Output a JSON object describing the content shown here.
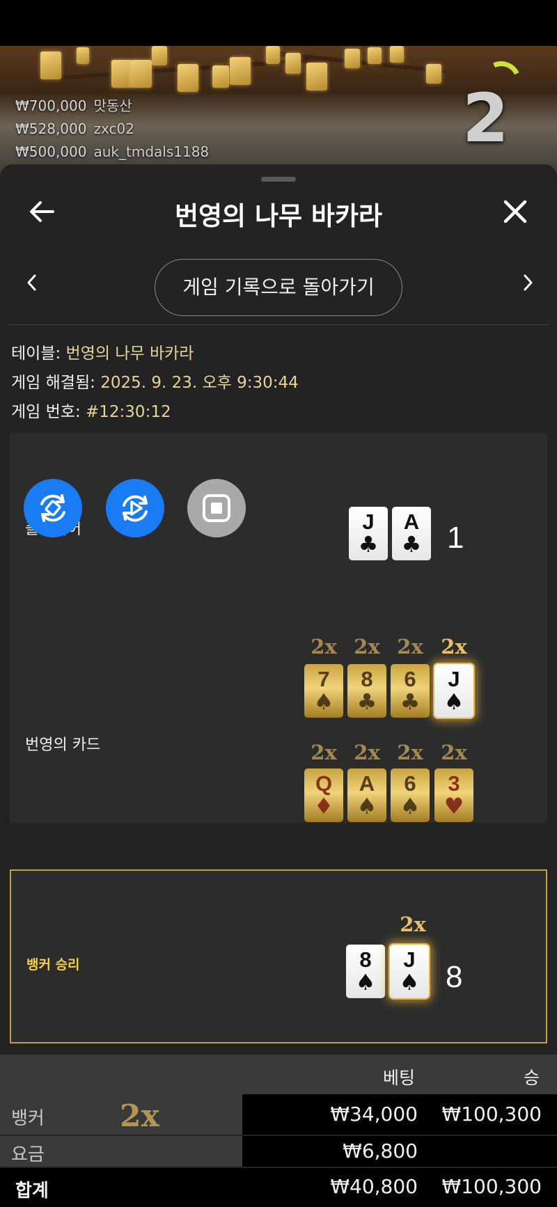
{
  "live": {
    "winners": [
      {
        "amount": "₩700,000",
        "name": "맛동산"
      },
      {
        "amount": "₩528,000",
        "name": "zxc02"
      },
      {
        "amount": "₩500,000",
        "name": "auk_tmdals1188"
      }
    ],
    "countdown": "2"
  },
  "header": {
    "title": "번영의 나무 바카라",
    "back_icon": "arrow-left-icon",
    "close_icon": "close-icon"
  },
  "nav": {
    "back_to_history": "게임 기록으로 돌아가기",
    "prev_icon": "chevron-left-icon",
    "next_icon": "chevron-right-icon"
  },
  "info": {
    "table_label": "테이블:",
    "table_value": "번영의 나무 바카라",
    "resolved_label": "게임 해결됨:",
    "resolved_value": "2025. 9. 23. 오후 9:30:44",
    "game_no_label": "게임 번호:",
    "game_no_value": "#12:30:12"
  },
  "controls": {
    "rotate_icon": "rotate-icon",
    "replay_icon": "replay-icon",
    "stop_icon": "stop-icon"
  },
  "player": {
    "label": "플레이어",
    "cards": [
      {
        "rank": "J",
        "suit": "♣"
      },
      {
        "rank": "A",
        "suit": "♣"
      }
    ],
    "score": "1"
  },
  "prosperity": {
    "label": "번영의 카드",
    "row1": [
      {
        "rank": "7",
        "suit": "♠",
        "mult": "2x"
      },
      {
        "rank": "8",
        "suit": "♣",
        "mult": "2x"
      },
      {
        "rank": "6",
        "suit": "♣",
        "mult": "2x"
      },
      {
        "rank": "J",
        "suit": "♠",
        "mult": "2x"
      }
    ],
    "row2": [
      {
        "rank": "Q",
        "suit": "♦",
        "mult": "2x"
      },
      {
        "rank": "A",
        "suit": "♠",
        "mult": "2x"
      },
      {
        "rank": "6",
        "suit": "♠",
        "mult": "2x"
      },
      {
        "rank": "3",
        "suit": "♥",
        "mult": "2x"
      }
    ]
  },
  "banker": {
    "label": "뱅커 승리",
    "mult": "2x",
    "cards": [
      {
        "rank": "8",
        "suit": "♠"
      },
      {
        "rank": "J",
        "suit": "♠"
      }
    ],
    "score": "8"
  },
  "bets": {
    "col_bet": "베팅",
    "col_win": "승",
    "rows": [
      {
        "label": "뱅커",
        "mult": "2x",
        "bet": "₩34,000",
        "win": "₩100,300"
      },
      {
        "label": "요금",
        "bet": "₩6,800",
        "win": ""
      },
      {
        "label": "합계",
        "bet": "₩40,800",
        "win": "₩100,300"
      }
    ]
  }
}
